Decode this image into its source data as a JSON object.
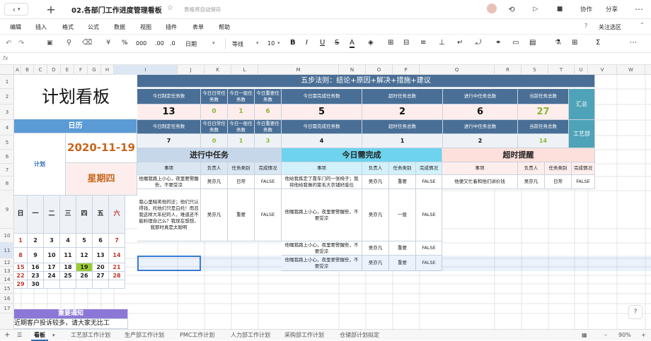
{
  "doc": {
    "title": "02.各部门工作进度管理看板",
    "autosave": "表格将自动保存",
    "collab": "协作",
    "share": "分享"
  },
  "menu": [
    "编辑",
    "插入",
    "格式",
    "公式",
    "数据",
    "视图",
    "插件",
    "表单",
    "帮助"
  ],
  "menu_right": "关注选区",
  "toolbar": {
    "percent": "%",
    "thousands": "000",
    "dec_add": ".00",
    "dec_sub": ".0",
    "num_format": "日期",
    "font": "等线",
    "size": "10"
  },
  "formula_prefix": "fx",
  "columns": [
    "A",
    "B",
    "C",
    "D",
    "E",
    "F",
    "G",
    "H",
    "I",
    "J",
    "K",
    "L",
    "M",
    "N",
    "O",
    "P",
    "Q",
    "R",
    "S",
    "T",
    "U",
    "V",
    "W"
  ],
  "rows": [
    "1",
    "2",
    "3",
    "4",
    "5",
    "6",
    "7",
    "8",
    "9",
    "10",
    "11",
    "12",
    "13",
    "14",
    "15",
    "16",
    "17"
  ],
  "left": {
    "title": "计划看板",
    "cal_header": "日历",
    "plan": "计划",
    "date": "2020-11-19",
    "weekday": "星期四",
    "week_days": [
      "日",
      "一",
      "二",
      "三",
      "四",
      "五",
      "六"
    ],
    "weeks": [
      [
        "1",
        "2",
        "3",
        "4",
        "5",
        "6",
        "7"
      ],
      [
        "8",
        "9",
        "10",
        "11",
        "12",
        "13",
        "14"
      ],
      [
        "15",
        "16",
        "17",
        "18",
        "19",
        "20",
        "21"
      ],
      [
        "22",
        "23",
        "24",
        "25",
        "26",
        "27",
        "28"
      ],
      [
        "29",
        "30",
        "",
        "",
        "",
        "",
        ""
      ]
    ],
    "notice_title": "重要通知",
    "notice_text": "近期客户投诉较多，请大家无比工"
  },
  "summary": {
    "banner": "五步法则：结论+原因+解决+措施+建议",
    "headers": [
      "今日制定任务数",
      "今日日常任务数",
      "今日一般任务数",
      "今日重要任务数",
      "今日需完成任务数",
      "超时任务总数",
      "进行中任务总数",
      "当前任务总数"
    ],
    "total": [
      "13",
      "0",
      "1",
      "6",
      "5",
      "2",
      "6",
      "27"
    ],
    "dept": [
      "7",
      "0",
      "1",
      "3",
      "4",
      "1",
      "2",
      "14"
    ],
    "total_label": "汇总",
    "dept_label": "工艺部"
  },
  "sections": {
    "in_progress": "进行中任务",
    "due_today": "今日需完成",
    "overdue": "超时提醒"
  },
  "sub_headers": [
    "事项",
    "负责人",
    "任务类别",
    "完成情况"
  ],
  "ip_rows": [
    {
      "item": "他嘱我路上小心，夜里要警醒些，不要受凉",
      "owner": "吴亦凡",
      "cat": "日常",
      "status": "FALSE"
    },
    {
      "item": "我心里暗笑他的迂；他们只认得钱，托他们只是白托！而且我这样大年纪的人，难道还不能料理自己么？我现在想想，我那时真是太聪明",
      "owner": "吴亦凡",
      "cat": "重要",
      "status": "FALSE"
    }
  ],
  "dt_rows": [
    {
      "item": "他给我拣定了靠车门的一张椅子；我将他给我做的紫毛大衣铺好座位",
      "owner": "吴亦凡",
      "cat": "重要",
      "status": "FALSE"
    },
    {
      "item": "他嘱我路上小心，夜里要警醒些，不要受凉",
      "owner": "吴亦凡",
      "cat": "一般",
      "status": "FALSE"
    },
    {
      "item": "他嘱我路上小心，夜里要警醒些，不要受凉",
      "owner": "吴亦凡",
      "cat": "重要",
      "status": "FALSE"
    },
    {
      "item": "他嘱我路上小心，夜里要警醒些，不要受凉",
      "owner": "吴亦凡",
      "cat": "重要",
      "status": "FALSE"
    }
  ],
  "ov_rows": [
    {
      "item": "他便又忙着和他们讲价钱",
      "owner": "吴亦凡",
      "cat": "日常",
      "status": "FALSE"
    }
  ],
  "sheets": [
    "看板",
    "工艺部工作计划",
    "生产部工作计划",
    "PMC工作计划",
    "人力部工作计划",
    "采购部工作计划",
    "仓储部计划拟定"
  ],
  "zoom": "90%",
  "colors": {
    "dark": "#4a6f96",
    "green": "#9acd32",
    "cyan": "#6dd3ee",
    "calHeader": "#5a9bd6",
    "notice": "#8b78d6"
  }
}
